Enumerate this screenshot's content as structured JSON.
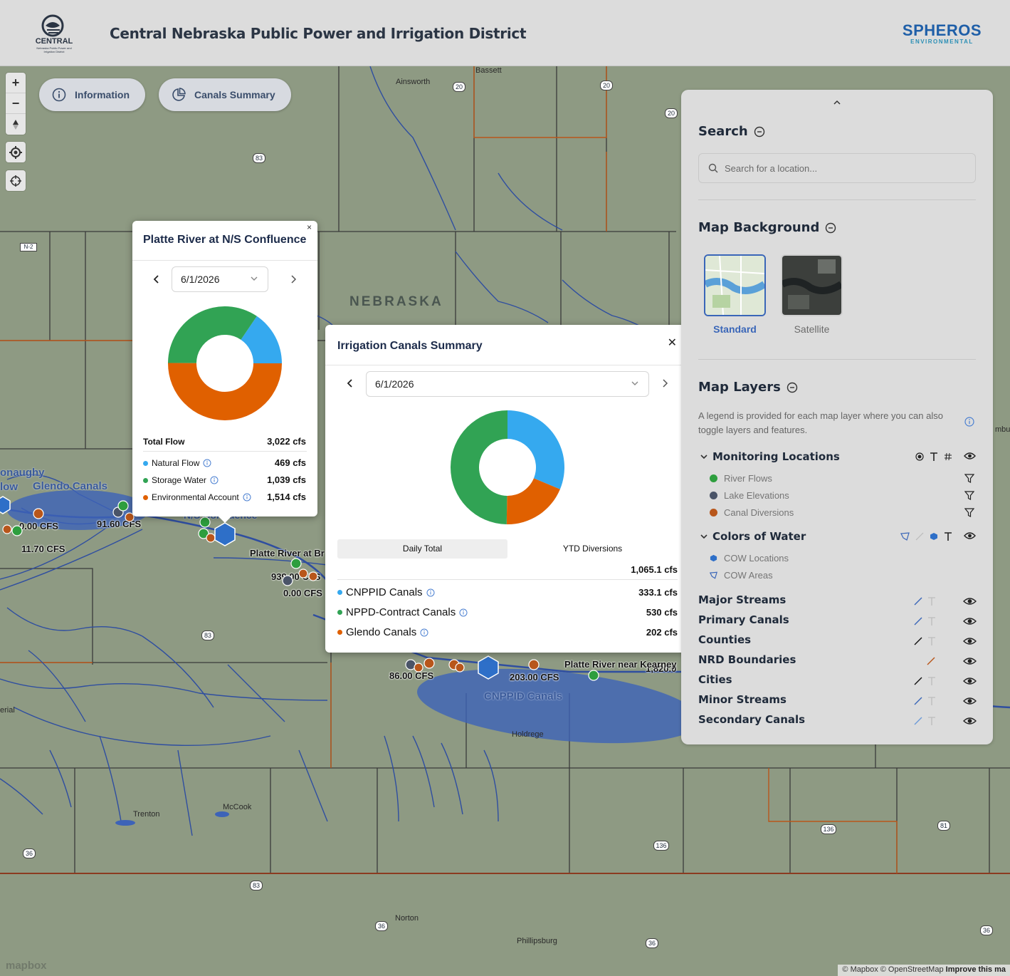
{
  "header": {
    "title": "Central Nebraska Public Power and Irrigation District",
    "logo_left_text": "CENTRAL",
    "logo_left_sub": "Nebraska Public Power and Irrigation District",
    "logo_right_name": "SPHEROS",
    "logo_right_sub": "ENVIRONMENTAL"
  },
  "toolbar": {
    "information_label": "Information",
    "canals_summary_label": "Canals Summary"
  },
  "map": {
    "state_label": "NEBRASKA",
    "places": [
      "Bassett",
      "Ainsworth",
      "Trenton",
      "McCook",
      "Holdrege",
      "Norton",
      "Phillipsburg"
    ],
    "route_shields": [
      "20",
      "20",
      "20",
      "83",
      "N-2",
      "83",
      "83",
      "36",
      "136",
      "136",
      "81",
      "36",
      "36",
      "36"
    ],
    "flow_labels": [
      "0.00 CFS",
      "11.70 CFS",
      "91.60 CFS",
      "939.00 CFS",
      "0.00 CFS",
      "86.00 CFS",
      "203.00 CFS",
      "1,820.0"
    ],
    "station_labels": [
      "Platte River at Br",
      "Platte River near Kearney",
      "N/S Confluence"
    ],
    "canal_labels": [
      "Glendo Canals",
      "CNPPID Canals"
    ],
    "partial_labels": [
      "onaughy",
      "low",
      "erial",
      "mbu"
    ],
    "attribution": "© Mapbox © OpenStreetMap",
    "improve": "Improve this ma",
    "mapbox_logo": "mapbox"
  },
  "popup_station": {
    "title": "Platte River at N/S Confluence",
    "close": "×",
    "date": "6/1/2026",
    "total_label": "Total Flow",
    "total_value": "3,022 cfs",
    "rows": [
      {
        "label": "Natural Flow",
        "value": "469 cfs",
        "color": "#35a9ef"
      },
      {
        "label": "Storage Water",
        "value": "1,039 cfs",
        "color": "#31a354"
      },
      {
        "label": "Environmental Account",
        "value": "1,514 cfs",
        "color": "#e06000"
      }
    ]
  },
  "popup_canals": {
    "title": "Irrigation Canals Summary",
    "close": "✕",
    "date": "6/1/2026",
    "tab_daily": "Daily Total",
    "tab_ytd": "YTD Diversions",
    "total_value": "1,065.1 cfs",
    "rows": [
      {
        "label": "CNPPID Canals",
        "value": "333.1 cfs",
        "color": "#35a9ef"
      },
      {
        "label": "NPPD-Contract Canals",
        "value": "530 cfs",
        "color": "#31a354"
      },
      {
        "label": "Glendo Canals",
        "value": "202 cfs",
        "color": "#e06000"
      }
    ]
  },
  "sidebar": {
    "search_title": "Search",
    "search_placeholder": "Search for a location...",
    "background_title": "Map Background",
    "bg_standard": "Standard",
    "bg_satellite": "Satellite",
    "layers_title": "Map Layers",
    "layers_desc": "A legend is provided for each map layer where you can also toggle layers and features.",
    "monitoring_title": "Monitoring Locations",
    "monitoring_items": [
      {
        "label": "River Flows",
        "color": "#2e9e3e"
      },
      {
        "label": "Lake Elevations",
        "color": "#4a5468"
      },
      {
        "label": "Canal Diversions",
        "color": "#b8561b"
      }
    ],
    "cow_title": "Colors of Water",
    "cow_items": [
      "COW Locations",
      "COW Areas"
    ],
    "layers": [
      "Major Streams",
      "Primary Canals",
      "Counties",
      "NRD Boundaries",
      "Cities",
      "Minor Streams",
      "Secondary Canals"
    ]
  },
  "chart_data": [
    {
      "type": "pie",
      "title": "Platte River at N/S Confluence",
      "categories": [
        "Natural Flow",
        "Storage Water",
        "Environmental Account"
      ],
      "values": [
        469,
        1039,
        1514
      ],
      "colors": [
        "#35a9ef",
        "#31a354",
        "#e06000"
      ]
    },
    {
      "type": "pie",
      "title": "Irrigation Canals Summary",
      "categories": [
        "CNPPID Canals",
        "NPPD-Contract Canals",
        "Glendo Canals"
      ],
      "values": [
        333.1,
        530,
        202
      ],
      "colors": [
        "#35a9ef",
        "#31a354",
        "#e06000"
      ]
    }
  ]
}
